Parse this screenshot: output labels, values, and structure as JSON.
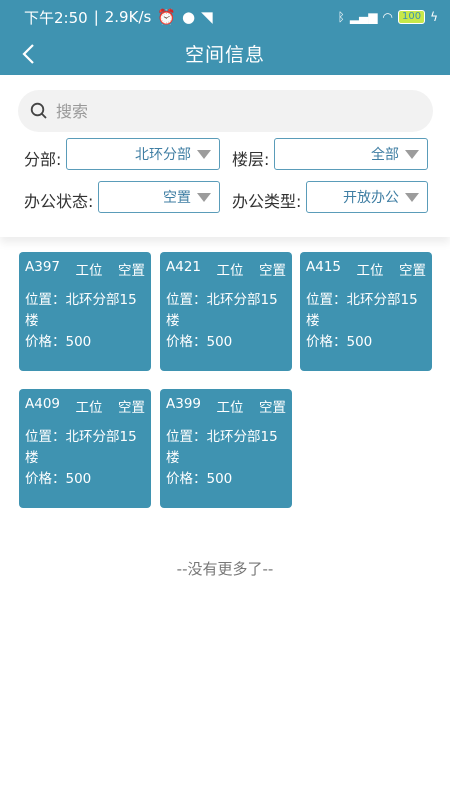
{
  "status_bar": {
    "time": "下午2:50",
    "speed": "2.9K/s",
    "battery": "100"
  },
  "header": {
    "title": "空间信息"
  },
  "search": {
    "placeholder": "搜索"
  },
  "filters": {
    "branch": {
      "label": "分部:",
      "value": "北环分部"
    },
    "floor": {
      "label": "楼层:",
      "value": "全部"
    },
    "office_status": {
      "label": "办公状态:",
      "value": "空置"
    },
    "office_type": {
      "label": "办公类型:",
      "value": "开放办公"
    }
  },
  "cards": [
    {
      "code": "A397",
      "type": "工位",
      "status": "空置",
      "location": "位置：北环分部15楼",
      "price": "价格：500"
    },
    {
      "code": "A421",
      "type": "工位",
      "status": "空置",
      "location": "位置：北环分部15楼",
      "price": "价格：500"
    },
    {
      "code": "A415",
      "type": "工位",
      "status": "空置",
      "location": "位置：北环分部15楼",
      "price": "价格：500"
    },
    {
      "code": "A409",
      "type": "工位",
      "status": "空置",
      "location": "位置：北环分部15楼",
      "price": "价格：500"
    },
    {
      "code": "A399",
      "type": "工位",
      "status": "空置",
      "location": "位置：北环分部15楼",
      "price": "价格：500"
    }
  ],
  "footer": {
    "no_more": "--没有更多了--"
  }
}
